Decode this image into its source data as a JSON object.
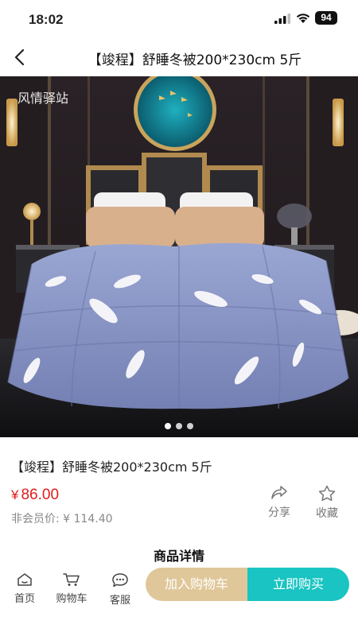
{
  "status_bar": {
    "time": "18:02",
    "battery": "94"
  },
  "nav": {
    "title": "【竣程】舒睡冬被200*230cm 5斤"
  },
  "hero": {
    "watermark": "风情驿站",
    "slides": 3,
    "active_slide": 1
  },
  "product": {
    "name": "【竣程】舒睡冬被200*230cm 5斤",
    "currency": "¥",
    "price": "86.00",
    "member_price_label": "非会员价: ¥ 114.40"
  },
  "actions": {
    "share": "分享",
    "favorite": "收藏"
  },
  "details_title": "商品详情",
  "bottom_bar": {
    "home": "首页",
    "cart": "购物车",
    "service": "客服",
    "add_to_cart": "加入购物车",
    "buy_now": "立即购买"
  },
  "colors": {
    "price": "#e01c1c",
    "cart_button": "#e0c79a",
    "buy_button": "#19c4c2"
  }
}
